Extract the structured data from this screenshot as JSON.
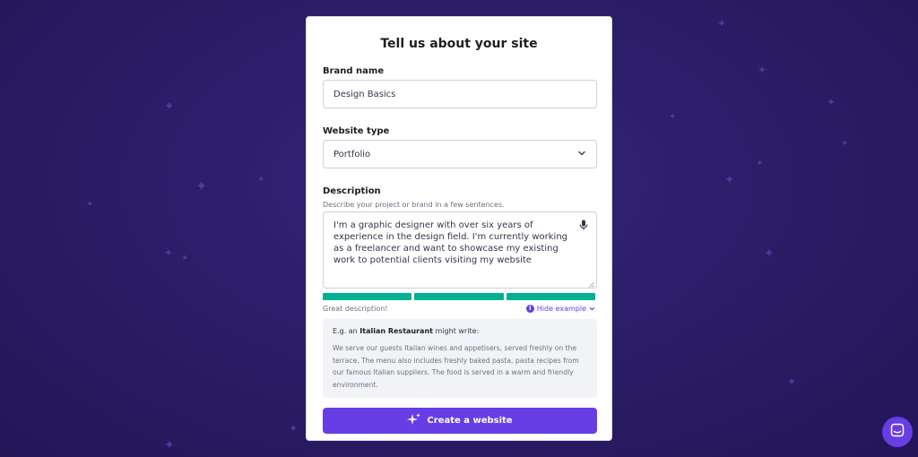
{
  "form": {
    "title": "Tell us about your site",
    "brand_name": {
      "label": "Brand name",
      "value": "Design Basics"
    },
    "website_type": {
      "label": "Website type",
      "value": "Portfolio"
    },
    "description": {
      "label": "Description",
      "hint": "Describe your project or brand in a few sentences.",
      "value": "I'm a graphic designer with over six years of experience in the design field. I'm currently working as a freelancer and want to showcase my existing work to potential clients visiting my website",
      "feedback": "Great description!",
      "strength_bars": 3,
      "hide_example_label": "Hide example"
    },
    "example": {
      "prefix": "E.g. an",
      "business": "Italian Restaurant",
      "suffix": "might write:",
      "text": "We serve our guests Italian wines and appetisers, served freshly on the terrace. The menu also includes freshly baked pasta, pasta recipes from our famous Italian suppliers. The food is served in a warm and friendly environment."
    },
    "submit_label": "Create a website"
  },
  "colors": {
    "accent": "#673de6",
    "success": "#00b090",
    "background": "#2a1c66"
  },
  "icons": [
    "sparkle-icon",
    "chevron-down-icon",
    "microphone-icon",
    "info-icon",
    "chat-icon"
  ]
}
